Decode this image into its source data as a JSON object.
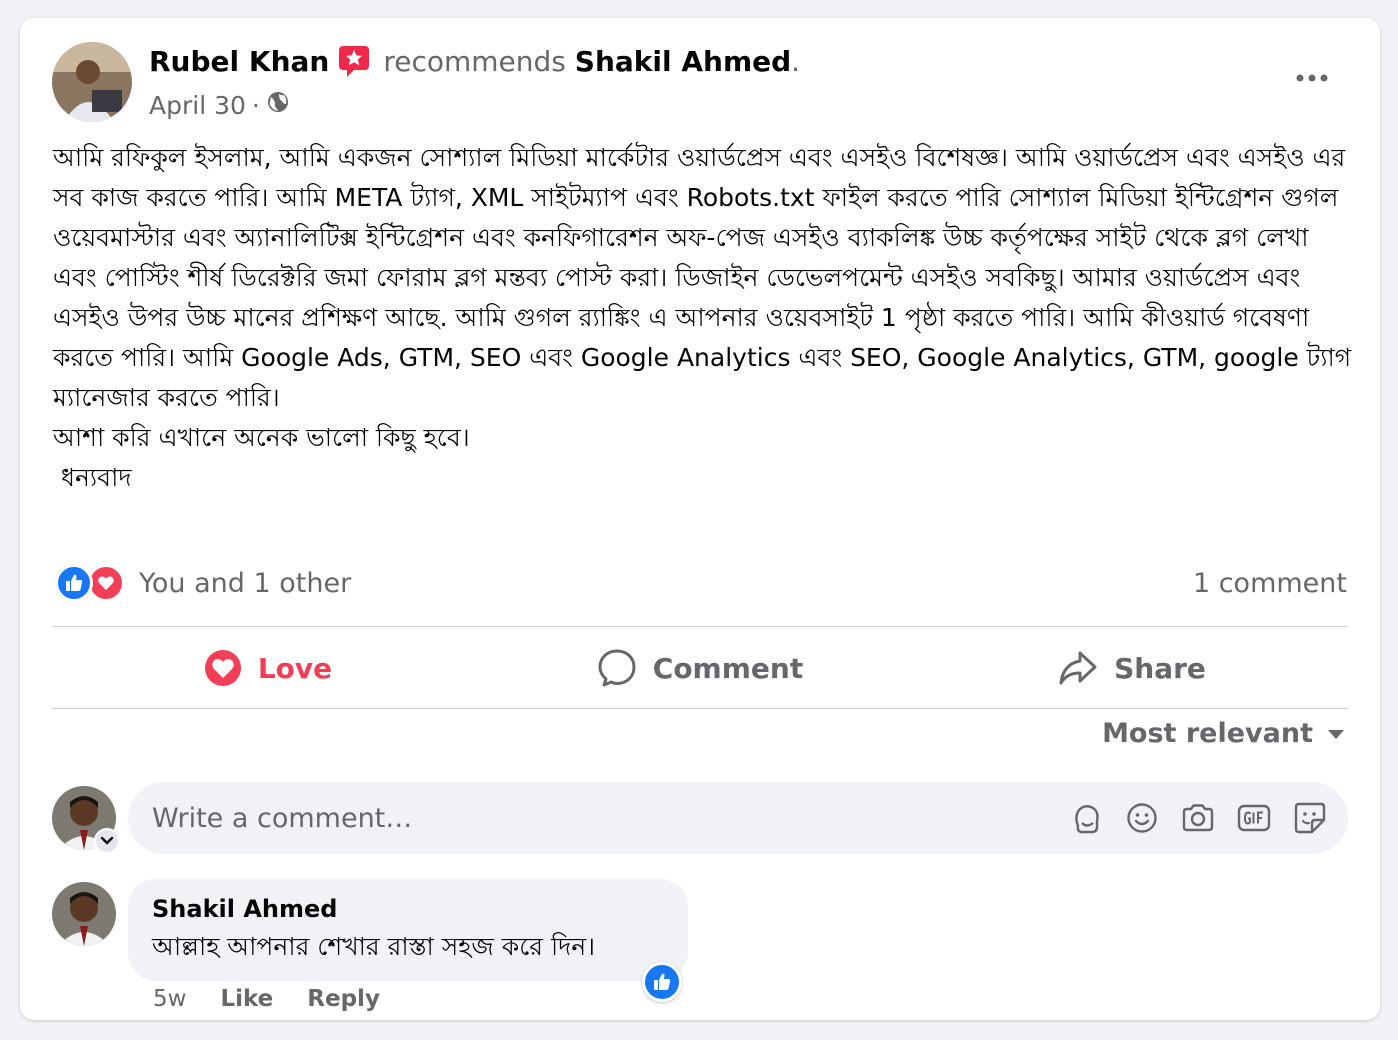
{
  "post": {
    "author": "Rubel Khan",
    "action": "recommends",
    "target": "Shakil Ahmed",
    "target_suffix": ".",
    "date": "April 30",
    "separator": "·",
    "privacy_icon": "globe-icon",
    "more_icon": "more-horizontal-icon",
    "paragraphs": [
      "আমি রফিকুল ইসলাম, আমি একজন সোশ্যাল মিডিয়া মার্কেটার ওয়ার্ডপ্রেস এবং এসইও বিশেষজ্ঞ। আমি ওয়ার্ডপ্রেস এবং এসইও এর সব কাজ করতে পারি। আমি META ট্যাগ, XML সাইটম্যাপ এবং Robots.txt ফাইল করতে পারি সোশ্যাল মিডিয়া ইন্টিগ্রেশন গুগল ওয়েবমাস্টার এবং অ্যানালিটিক্স ইন্টিগ্রেশন এবং কনফিগারেশন অফ-পেজ এসইও ব্যাকলিঙ্ক উচ্চ কর্তৃপক্ষের সাইট থেকে ব্লগ লেখা এবং পোস্টিং শীর্ষ ডিরেক্টরি জমা ফোরাম ব্লগ মন্তব্য পোস্ট করা। ডিজাইন ডেভেলপমেন্ট এসইও সবকিছু। আমার ওয়ার্ডপ্রেস এবং এসইও উপর উচ্চ মানের প্রশিক্ষণ আছে. আমি গুগল র‍্যাঙ্কিং এ আপনার ওয়েবসাইট 1 পৃষ্ঠা করতে পারি। আমি কীওয়ার্ড গবেষণা করতে পারি। আমি Google Ads, GTM, SEO এবং Google Analytics এবং SEO, Google Analytics, GTM, google ট্যাগ ম্যানেজার করতে পারি।",
      "আশা করি এখানে অনেক ভালো কিছু হবে।",
      "ধন্যবাদ"
    ]
  },
  "reactions": {
    "summary": "You and 1 other",
    "comment_count": "1 comment",
    "like_color": "#1877f2",
    "love_color": "#f33e58"
  },
  "actions": {
    "love": "Love",
    "comment": "Comment",
    "share": "Share"
  },
  "sort": {
    "label": "Most relevant"
  },
  "composer": {
    "placeholder": "Write a comment…",
    "tools": [
      "avatar-sticker-icon",
      "emoji-icon",
      "camera-icon",
      "gif-icon",
      "sticker-icon"
    ]
  },
  "comments": [
    {
      "author": "Shakil Ahmed",
      "text": "আল্লাহ আপনার শেখার রাস্তা সহজ করে দিন।",
      "age": "5w",
      "like": "Like",
      "reply": "Reply"
    }
  ],
  "colors": {
    "accent": "#1877f2",
    "love": "#f33e58",
    "muted_text": "#65676b",
    "bubble_bg": "#f0f2f5"
  }
}
